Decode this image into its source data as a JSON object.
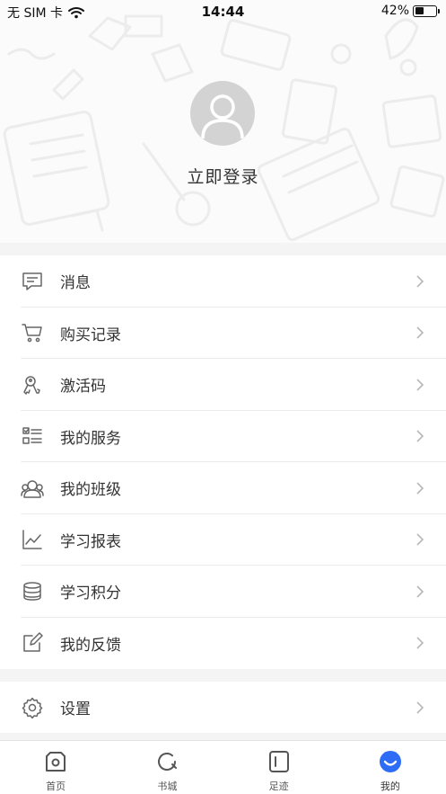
{
  "status_bar": {
    "carrier": "无 SIM 卡",
    "time": "14:44",
    "battery_percent": "42%",
    "battery_level": 0.42
  },
  "profile": {
    "login_label": "立即登录"
  },
  "menu": {
    "group1": [
      {
        "label": "消息",
        "icon": "message-icon"
      },
      {
        "label": "购买记录",
        "icon": "cart-icon"
      },
      {
        "label": "激活码",
        "icon": "key-icon"
      },
      {
        "label": "我的服务",
        "icon": "service-list-icon"
      },
      {
        "label": "我的班级",
        "icon": "class-icon"
      },
      {
        "label": "学习报表",
        "icon": "chart-icon"
      },
      {
        "label": "学习积分",
        "icon": "coins-icon"
      },
      {
        "label": "我的反馈",
        "icon": "feedback-edit-icon"
      }
    ],
    "group2": [
      {
        "label": "设置",
        "icon": "gear-icon"
      }
    ]
  },
  "tabbar": {
    "tabs": [
      {
        "label": "首页",
        "icon": "home-icon",
        "active": false
      },
      {
        "label": "书城",
        "icon": "bookstore-icon",
        "active": false
      },
      {
        "label": "足迹",
        "icon": "footprint-icon",
        "active": false
      },
      {
        "label": "我的",
        "icon": "profile-face-icon",
        "active": true
      }
    ],
    "active_color": "#2f6cf6",
    "inactive_color": "#555555"
  }
}
